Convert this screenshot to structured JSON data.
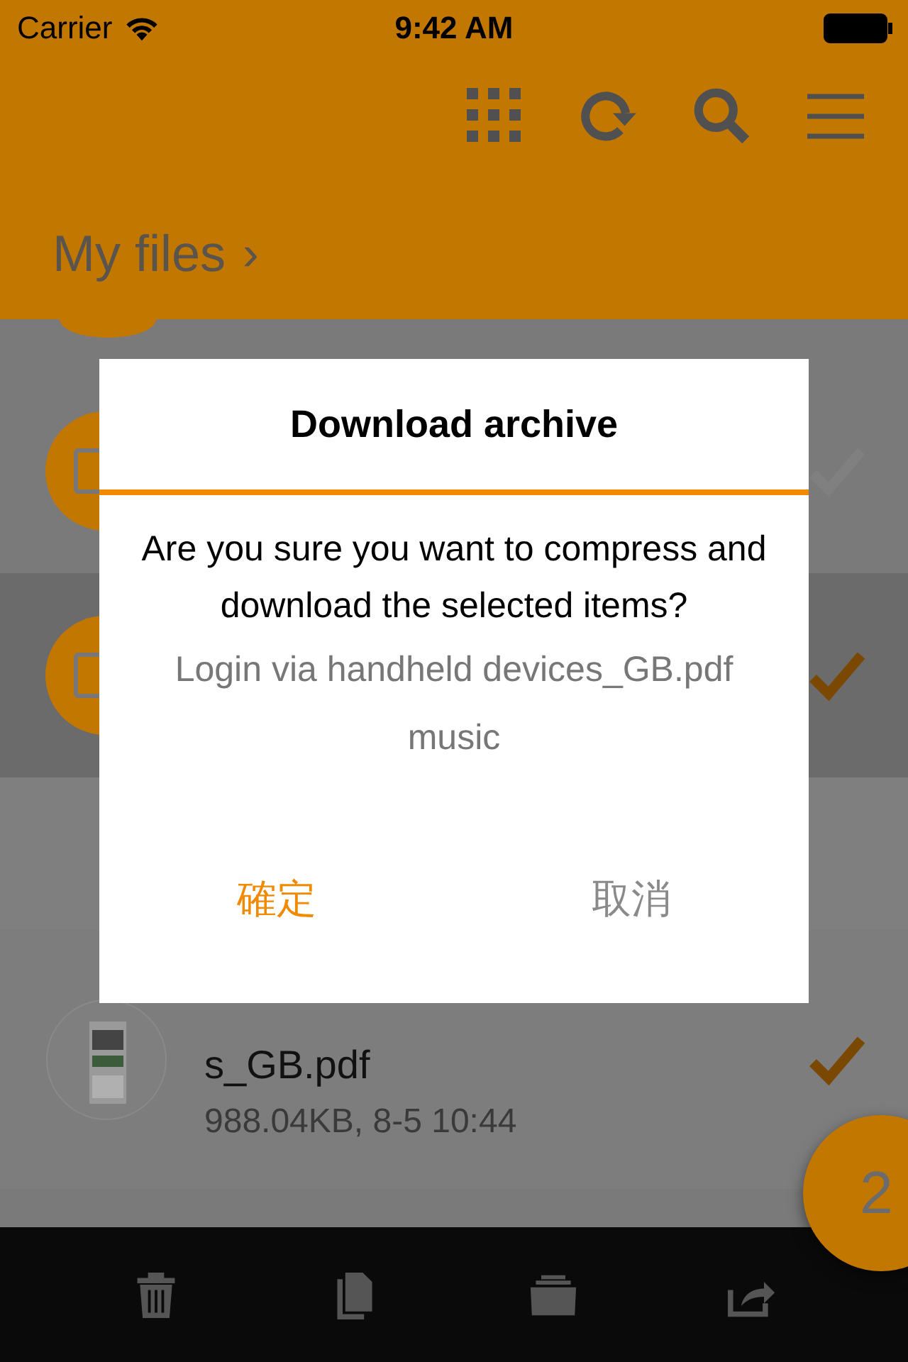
{
  "status_bar": {
    "carrier": "Carrier",
    "time": "9:42 AM"
  },
  "header": {
    "breadcrumb": "My files",
    "chevron": "›"
  },
  "rows": [
    {
      "kind": "folder",
      "selected": false,
      "checked": false
    },
    {
      "kind": "folder",
      "selected": true,
      "checked": true
    },
    {
      "kind": "file",
      "selected": false,
      "checked": true,
      "title": "s_GB.pdf",
      "meta": "988.04KB, 8-5 10:44"
    }
  ],
  "selection_badge": "2",
  "dialog": {
    "title": "Download archive",
    "message": "Are you sure you want to compress and download the selected items?",
    "items": [
      "Login via handheld devices_GB.pdf",
      "music"
    ],
    "confirm": "確定",
    "cancel": "取消"
  }
}
